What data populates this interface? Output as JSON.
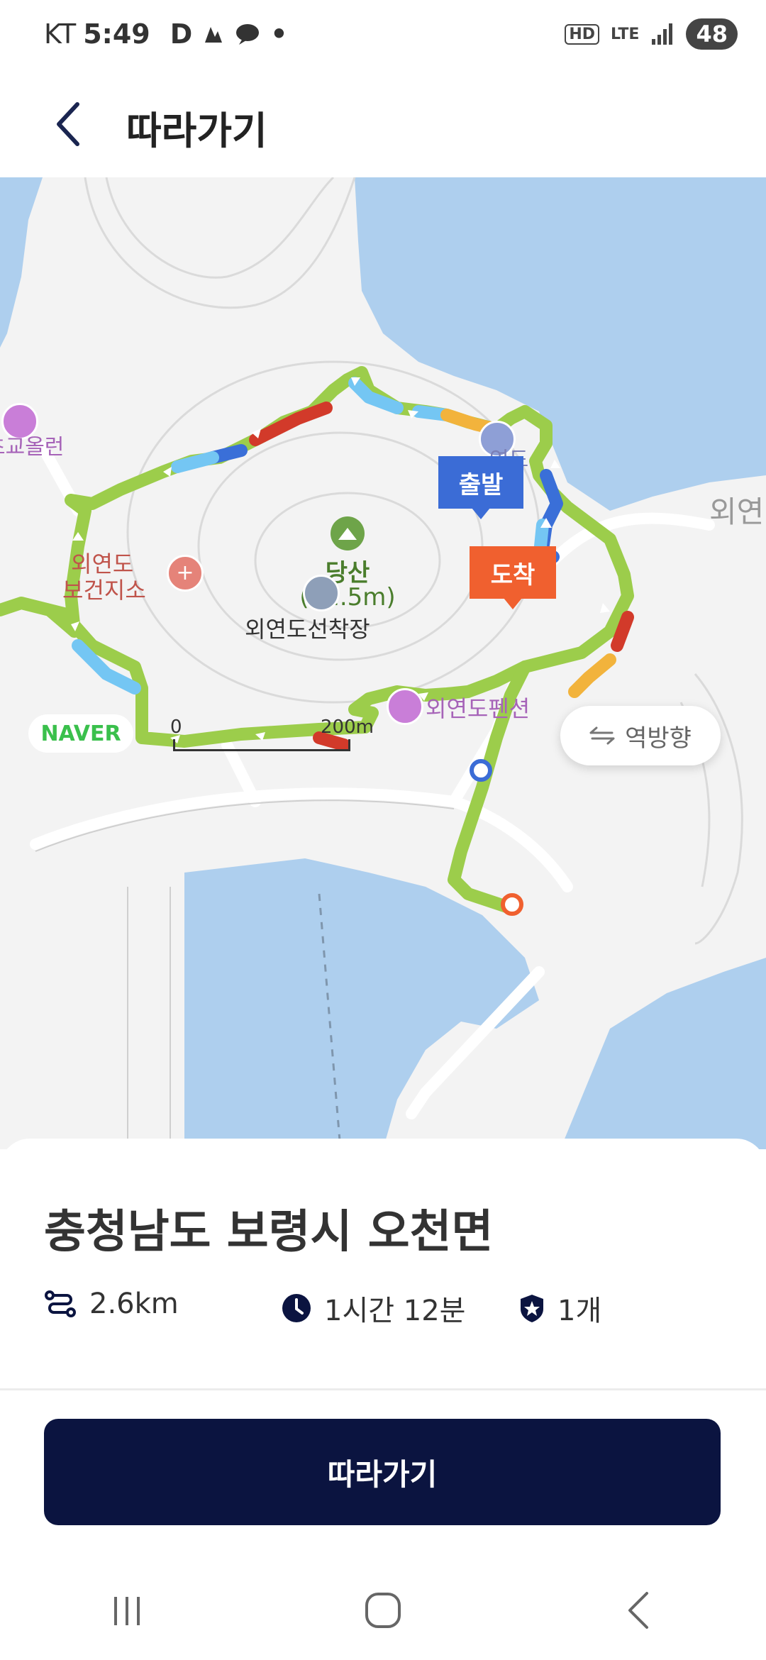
{
  "status_bar": {
    "carrier": "KT",
    "time": "5:49",
    "notif_text": "D",
    "dot": "•",
    "hd": "HD",
    "lte": "LTE",
    "battery": "48"
  },
  "header": {
    "title": "따라가기",
    "back_icon": "chevron-left-icon"
  },
  "map": {
    "peak_name": "당산",
    "peak_elevation": "(72.5m)",
    "start_marker": "출발",
    "end_marker": "도착",
    "clinic_label_line1": "외연도",
    "clinic_label_line2": "보건지소",
    "ferry_label": "외연도선착장",
    "pension_label": "외연도펜션",
    "school_label": "연도",
    "left_poi_label": "초교올런",
    "right_label": "외연",
    "provider": "NAVER",
    "scale_start": "0",
    "scale_end": "200m",
    "reverse_button": "역방향",
    "colors": {
      "sea": "#aecfee",
      "land": "#f3f3f3",
      "route_green": "#9ccd4b",
      "route_red": "#d23a2a",
      "route_orange": "#f2b33c",
      "route_blue": "#3a6fd8",
      "route_lightblue": "#74c6f3",
      "start_marker": "#3b6cd6",
      "end_marker": "#f0602f"
    }
  },
  "summary": {
    "location": "충청남도 보령시 오천면",
    "distance": "2.6km",
    "duration": "1시간 12분",
    "badges": "1개"
  },
  "cta": {
    "follow_label": "따라가기"
  },
  "nav": {
    "recent_icon": "recent-apps-icon",
    "home_icon": "home-icon",
    "back_icon": "back-icon"
  }
}
